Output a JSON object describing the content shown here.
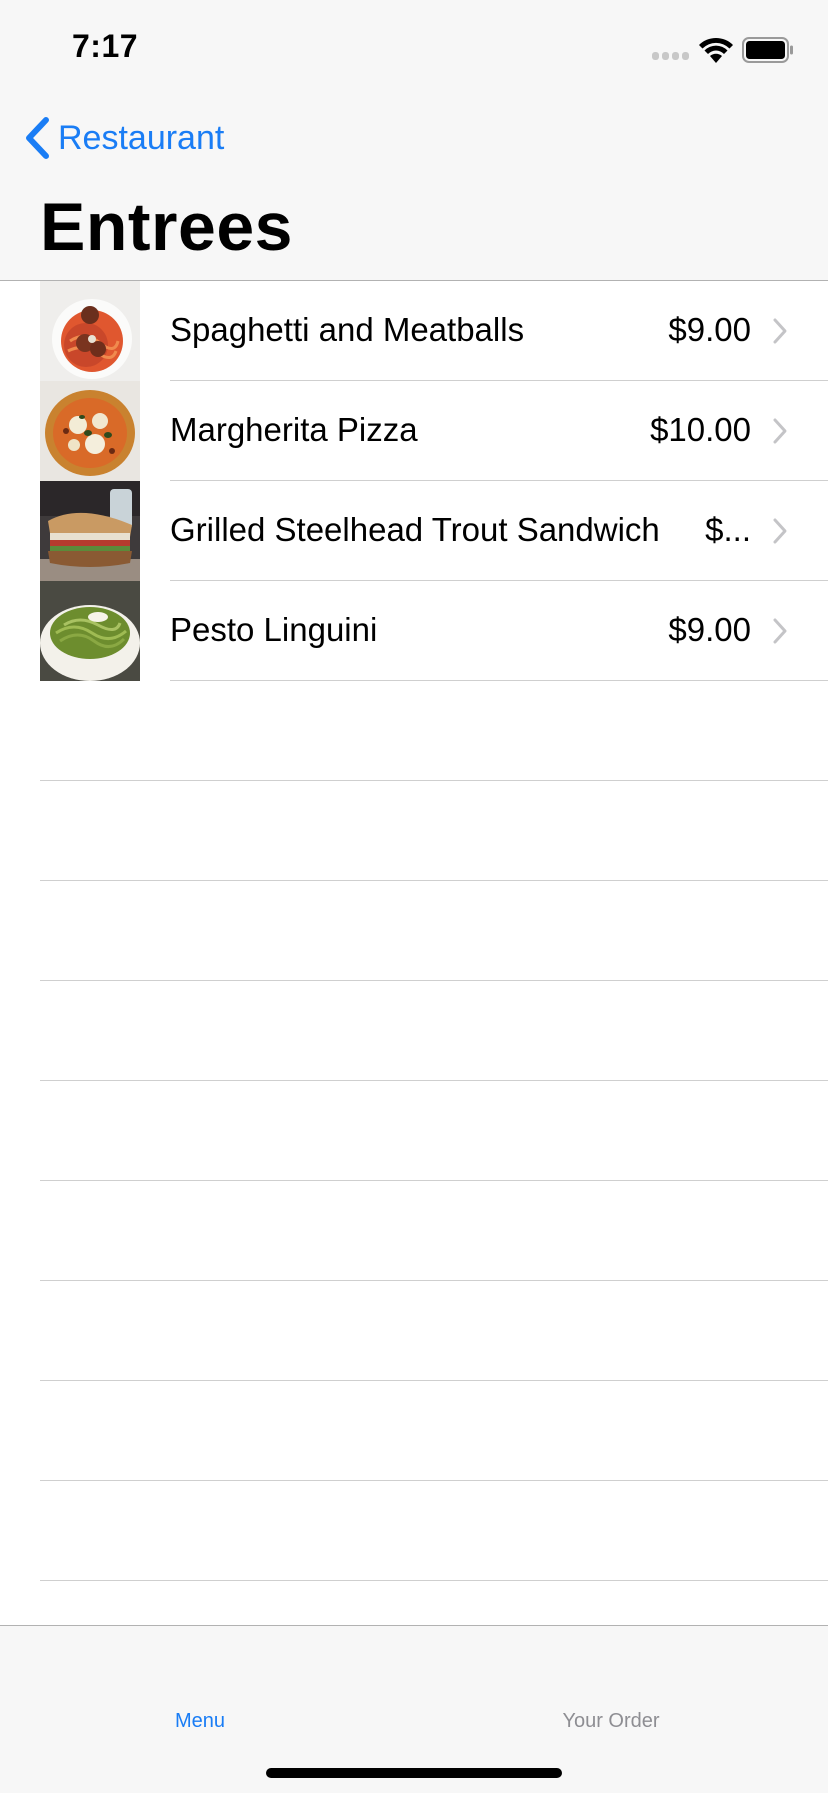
{
  "status_bar": {
    "time": "7:17"
  },
  "nav": {
    "back_label": "Restaurant",
    "title": "Entrees"
  },
  "menu_items": [
    {
      "name": "Spaghetti and Meatballs",
      "price": "$9.00",
      "image": "spaghetti-meatballs-photo"
    },
    {
      "name": "Margherita Pizza",
      "price": "$10.00",
      "image": "margherita-pizza-photo"
    },
    {
      "name": "Grilled Steelhead Trout Sandwich",
      "price": "$...",
      "image": "trout-sandwich-photo"
    },
    {
      "name": "Pesto Linguini",
      "price": "$9.00",
      "image": "pesto-linguini-photo"
    }
  ],
  "tab_bar": {
    "tabs": [
      {
        "label": "Menu",
        "selected": true
      },
      {
        "label": "Your Order",
        "selected": false
      }
    ]
  },
  "colors": {
    "accent": "#1a7df5",
    "inactive_tab": "#8e8e93",
    "bar_background": "#f7f7f7",
    "separator": "#cfcfcf"
  }
}
